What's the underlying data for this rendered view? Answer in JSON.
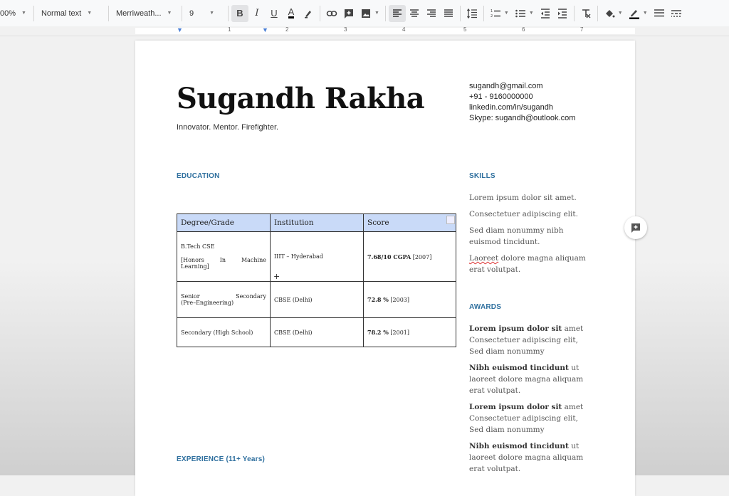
{
  "toolbar": {
    "zoom": "00%",
    "style": "Normal text",
    "font": "Merriweath...",
    "size": "9"
  },
  "ruler": [
    "1",
    "2",
    "3",
    "4",
    "5",
    "6",
    "7"
  ],
  "doc": {
    "name": "Sugandh Rakha",
    "tagline": "Innovator. Mentor. Firefighter.",
    "contact": [
      "sugandh@gmail.com",
      "+91 - 9160000000",
      "linkedin.com/in/sugandh",
      "Skype: sugandh@outlook.com"
    ],
    "education_heading": "EDUCATION",
    "experience_heading": "EXPERIENCE (11+ Years)",
    "table": {
      "headers": [
        "Degree/Grade",
        "Institution",
        "Score"
      ],
      "rows": [
        {
          "degree_line1": "B.Tech CSE",
          "degree_line2": "[Honors   In   Machine",
          "degree_line3": "Learning]",
          "institution": "IIIT – Hyderabad",
          "score_bold": "7.68/10 CGPA",
          "score_rest": " [2007]"
        },
        {
          "degree_line1": "Senior             Secondary",
          "degree_line2": "(Pre–Engineering)",
          "institution": "CBSE (Delhi)",
          "score_bold": "72.8 %",
          "score_rest": " [2003]"
        },
        {
          "degree_line1": "Secondary (High School)",
          "institution": "CBSE (Delhi)",
          "score_bold": "78.2 %",
          "score_rest": " [2001]"
        }
      ]
    },
    "skills_heading": "SKILLS",
    "skills": [
      "Lorem ipsum dolor sit amet.",
      "Consectetuer adipiscing elit.",
      "Sed diam nonummy nibh euismod tincidunt.",
      {
        "word": "Laoreet",
        "rest": " dolore magna aliquam erat volutpat."
      }
    ],
    "awards_heading": "AWARDS",
    "awards": [
      {
        "bold": "Lorem ipsum dolor sit",
        "rest": " amet Consectetuer adipiscing elit, Sed diam nonummy"
      },
      {
        "bold": "Nibh euismod tincidunt",
        "rest": " ut laoreet dolore magna aliquam erat volutpat."
      },
      {
        "bold": "Lorem ipsum dolor sit",
        "rest": " amet Consectetuer adipiscing elit, Sed diam nonummy"
      },
      {
        "bold": "Nibh euismod tincidunt",
        "rest": " ut laoreet dolore magna aliquam erat volutpat."
      }
    ]
  },
  "colors": {
    "heading": "#2e6f9e",
    "table_header": "#c9daf8"
  }
}
